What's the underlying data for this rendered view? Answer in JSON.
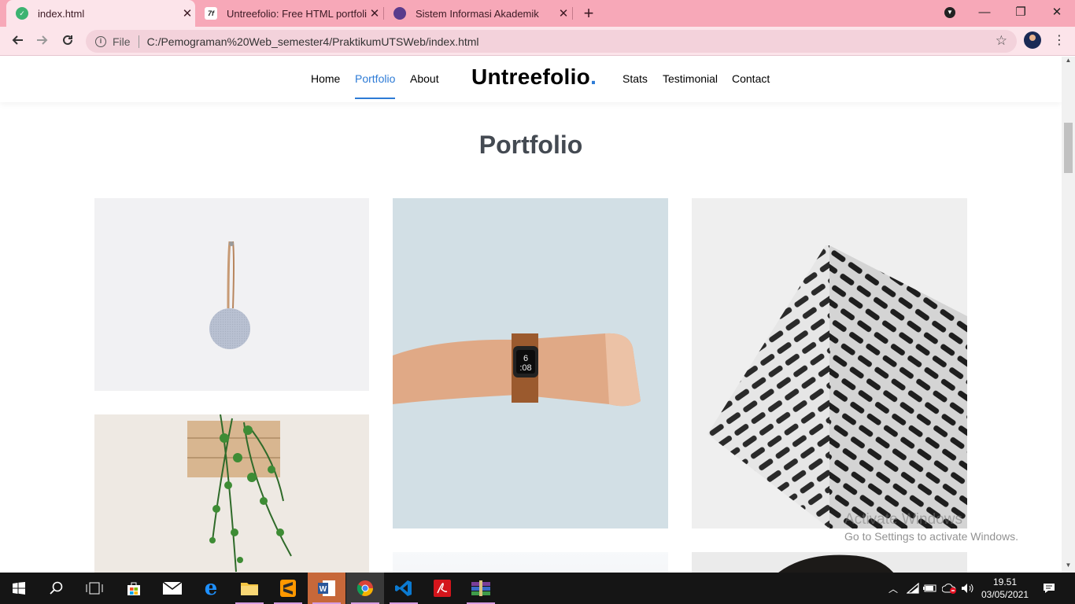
{
  "browser": {
    "tabs": [
      {
        "title": "index.html",
        "favicon": "green-leaf-icon",
        "active": true
      },
      {
        "title": "Untreefolio: Free HTML portfolio",
        "favicon": "untree-logo-icon",
        "active": false
      },
      {
        "title": "Sistem Informasi Akademik",
        "favicon": "university-logo-icon",
        "active": false
      }
    ],
    "address": {
      "scheme_label": "File",
      "url": "C:/Pemograman%20Web_semester4/PraktikumUTSWeb/index.html"
    }
  },
  "site": {
    "nav_left": [
      "Home",
      "Portfolio",
      "About"
    ],
    "brand": "Untreefolio",
    "brand_dot": ".",
    "nav_right": [
      "Stats",
      "Testimonial",
      "Contact"
    ],
    "active_nav": "Portfolio",
    "accent": "#2d7bd6"
  },
  "portfolio": {
    "title": "Portfolio",
    "items": [
      {
        "alt": "Round fabric speaker hanging on white wall",
        "bg": "#f0f0f2"
      },
      {
        "alt": "Smartwatch on a wrist against light blue background",
        "bg": "#d3e0e6"
      },
      {
        "alt": "Geometric white building facade",
        "bg": "#eeeff0"
      },
      {
        "alt": "Hanging ivy plant on wooden crate",
        "bg": "#ece6df"
      },
      {
        "alt": "Partial image below",
        "bg": "#f7f9fb"
      },
      {
        "alt": "Person with dark hair, partial",
        "bg": "#e9e9e9"
      }
    ]
  },
  "watermark": {
    "line1": "Activate Windows",
    "line2": "Go to Settings to activate Windows."
  },
  "taskbar": {
    "time": "19.51",
    "date": "03/05/2021"
  }
}
